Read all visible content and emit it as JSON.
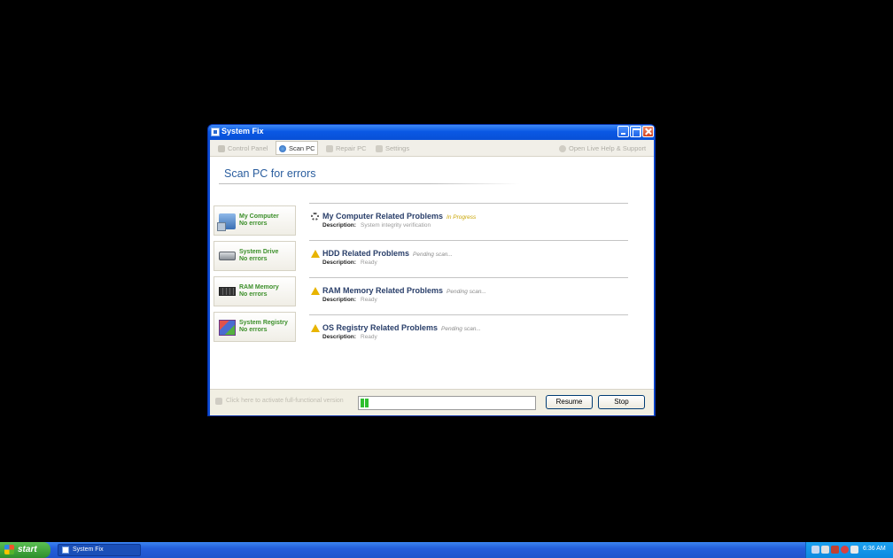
{
  "window": {
    "title": "System Fix",
    "buttons": {
      "minimize": "minimize",
      "maximize": "maximize",
      "close": "close"
    }
  },
  "toolbar": {
    "items": [
      {
        "label": "Control Panel",
        "icon": "control-panel-icon",
        "active": false
      },
      {
        "label": "Scan PC",
        "icon": "scan-icon",
        "active": true
      },
      {
        "label": "Repair PC",
        "icon": "repair-icon",
        "active": false
      },
      {
        "label": "Settings",
        "icon": "settings-icon",
        "active": false
      }
    ],
    "help": "Open Live Help & Support"
  },
  "main": {
    "title": "Scan PC for errors",
    "cards": [
      {
        "name": "My Computer",
        "status": "No errors",
        "icon": "computer-icon"
      },
      {
        "name": "System Drive",
        "status": "No errors",
        "icon": "drive-icon"
      },
      {
        "name": "RAM Memory",
        "status": "No errors",
        "icon": "ram-icon"
      },
      {
        "name": "System Registry",
        "status": "No errors",
        "icon": "registry-icon"
      }
    ],
    "problems": [
      {
        "title": "My Computer Related Problems",
        "state": "In Progress",
        "desc_label": "Description:",
        "desc": "System integrity verification",
        "icon": "spinner-icon"
      },
      {
        "title": "HDD Related Problems",
        "state": "Pending scan...",
        "desc_label": "Description:",
        "desc": "Ready",
        "icon": "warning-icon"
      },
      {
        "title": "RAM Memory Related Problems",
        "state": "Pending scan...",
        "desc_label": "Description:",
        "desc": "Ready",
        "icon": "warning-icon"
      },
      {
        "title": "OS Registry Related Problems",
        "state": "Pending scan...",
        "desc_label": "Description:",
        "desc": "Ready",
        "icon": "warning-icon"
      }
    ]
  },
  "footer": {
    "activate": "Click here to activate full-functional version",
    "progress": 0.05,
    "resume": "Resume",
    "stop": "Stop"
  },
  "taskbar": {
    "start": "start",
    "task": "System Fix",
    "clock": "6:36 AM"
  },
  "colors": {
    "accent": "#2a5d9e",
    "ok_green": "#3c8f2a",
    "warning": "#e8b400",
    "progress_green": "#2fbf2f",
    "titlebar_blue": "#0a58e4"
  }
}
